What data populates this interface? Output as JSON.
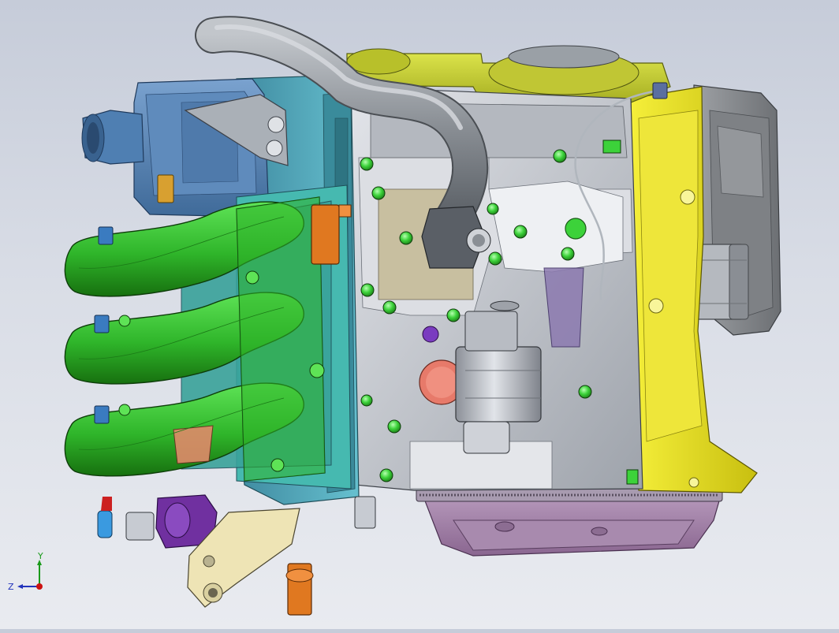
{
  "viewport": {
    "background_top": "#c6ccd9",
    "background_bottom": "#e9ebf0"
  },
  "model": {
    "palette": {
      "intake_manifold": "#2fb52a",
      "intake_manifold_shadow": "#1b7a17",
      "cylinder_head": "#4aa6b8",
      "head_cover": "#5c86b8",
      "engine_block": "#c9ccd3",
      "block_shadow": "#8e939c",
      "transmission_case": "#e8e21a",
      "timing_cover": "#c8d23a",
      "bellhousing": "#8a8d91",
      "flywheel": "#9a8aa6",
      "oil_pan": "#a27fa6",
      "coolant_hose": "#8a8f95",
      "starter_motor": "#c7cbd2",
      "bracket": "#eee4b5",
      "egr_valve": "#7030a0",
      "sensor_orange": "#e07820",
      "bolt_green": "#3cd23a",
      "thermostat_housing": "#5a5f66",
      "oil_filter": "#b5b9bf"
    }
  },
  "triad": {
    "labels": {
      "x": "",
      "y": "Y",
      "z": "Z"
    },
    "colors": {
      "y": "#1a9a1a",
      "z": "#2233bb",
      "x": "#cc1111"
    }
  }
}
